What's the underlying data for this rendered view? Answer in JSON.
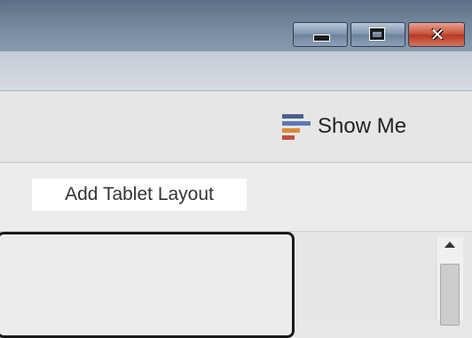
{
  "window_controls": {
    "minimize": "minimize",
    "maximize": "maximize",
    "close": "close",
    "close_glyph": "✕"
  },
  "toolbar": {
    "show_me": {
      "label": "Show Me",
      "icon": "show-me-icon",
      "icon_colors": [
        "#4a5f8a",
        "#5d79b4",
        "#d98b3a",
        "#c94b3b"
      ]
    }
  },
  "dashboard": {
    "add_tablet_layout_label": "Add Tablet Layout"
  },
  "colors": {
    "titlebar": "#6d8197",
    "close_button": "#c8533b",
    "toolbar_bg": "#e6e6e6"
  }
}
